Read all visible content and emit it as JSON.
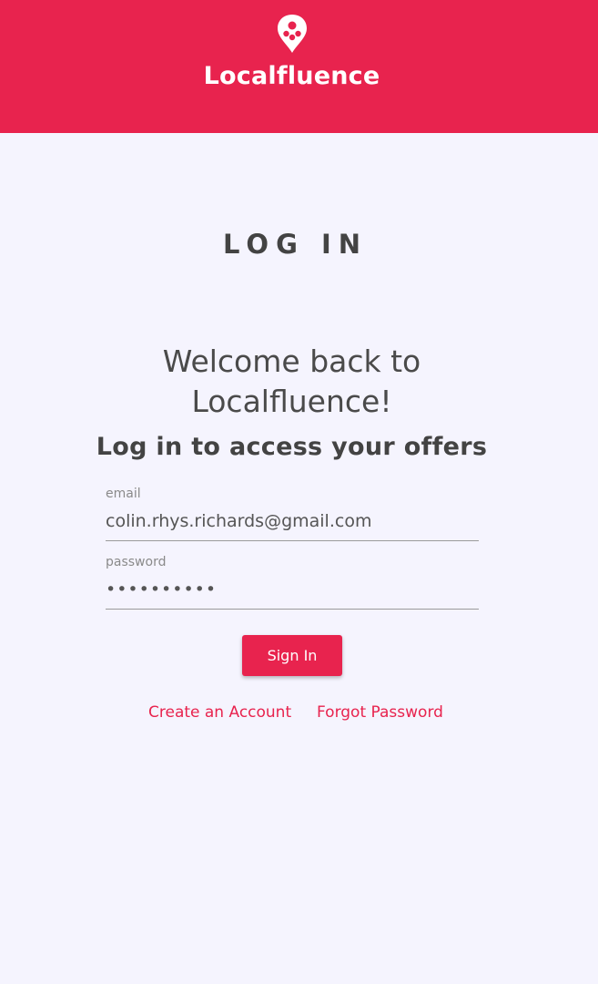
{
  "header": {
    "brand": "Localfluence",
    "logo_icon": "location-pin-icon",
    "background_color": "#e8234e"
  },
  "main": {
    "page_title": "LOG IN",
    "welcome_line1": "Welcome back to",
    "welcome_line2": "Localfluence!",
    "subtitle": "Log in to access your offers"
  },
  "form": {
    "email_label": "email",
    "email_value": "colin.rhys.richards@gmail.com",
    "password_label": "password",
    "password_value": "••••••••••",
    "signin_label": "Sign In"
  },
  "links": {
    "create_account": "Create an Account",
    "forgot_password": "Forgot Password"
  },
  "colors": {
    "accent": "#e8234e",
    "background": "#f5f4fe",
    "text_dark": "#434343"
  }
}
